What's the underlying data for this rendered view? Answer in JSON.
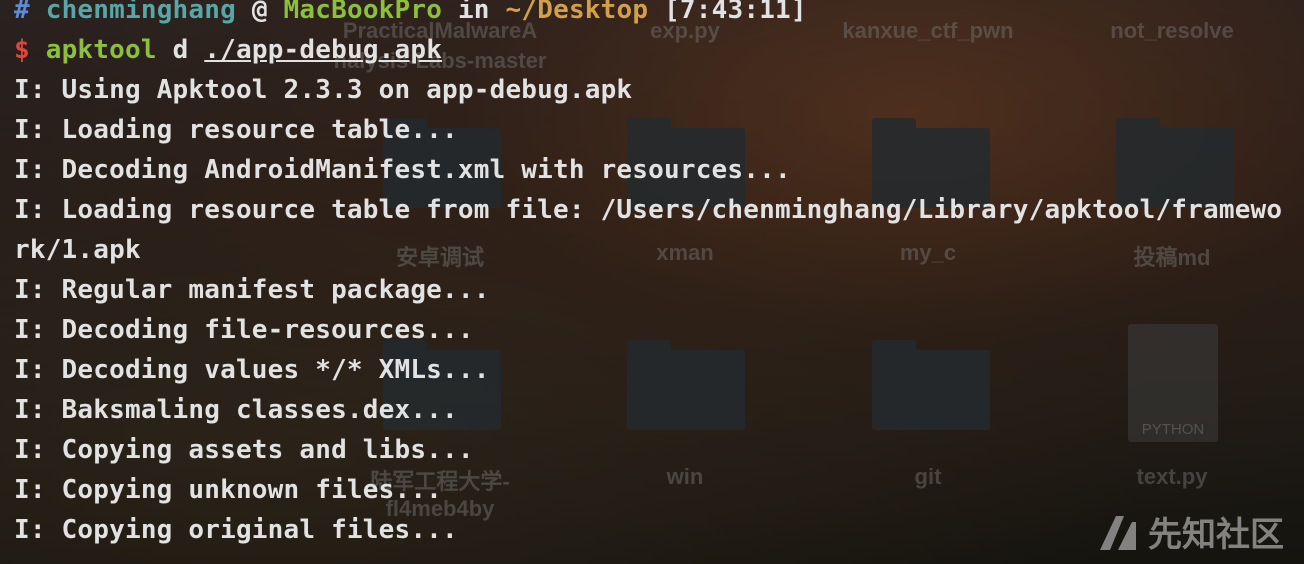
{
  "prompt": {
    "hash": "#",
    "user": "chenminghang",
    "at": "@",
    "host": "MacBookPro",
    "in": "in",
    "cwd": "~/Desktop",
    "time": "[7:43:11]",
    "dollar": "$",
    "command": "apktool",
    "subcommand": "d",
    "argument": "./app-debug.apk"
  },
  "output_lines": [
    "I: Using Apktool 2.3.3 on app-debug.apk",
    "I: Loading resource table...",
    "I: Decoding AndroidManifest.xml with resources...",
    "I: Loading resource table from file: /Users/chenminghang/Library/apktool/framewo",
    "rk/1.apk",
    "I: Regular manifest package...",
    "I: Decoding file-resources...",
    "I: Decoding values */* XMLs...",
    "I: Baksmaling classes.dex...",
    "I: Copying assets and libs...",
    "I: Copying unknown files...",
    "I: Copying original files..."
  ],
  "desktop": {
    "labels": {
      "practical": "PracticalMalwareA",
      "practical2": "nalysis-Labs-master",
      "exp": "exp.py",
      "kanxue": "kanxue_ctf_pwn",
      "notresolve": "not_resolve",
      "anzhuo": "安卓调试",
      "xman": "xman",
      "myc": "my_c",
      "tougao": "投稿md",
      "lujun": "陆军工程大学-",
      "lujun2": "fl4meb4by",
      "win": "win",
      "git": "git",
      "text": "text.py"
    },
    "python_badge": "PYTHON"
  },
  "watermark": {
    "text": "先知社区",
    "logo_icon": "xianzhi-logo-icon"
  }
}
